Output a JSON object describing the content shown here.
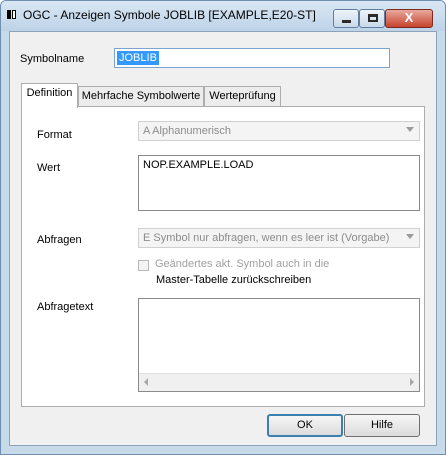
{
  "window": {
    "title": "OGC - Anzeigen Symbole JOBLIB [EXAMPLE,E20-ST]",
    "close_glyph": "X"
  },
  "symbolname": {
    "label": "Symbolname",
    "value": "JOBLIB"
  },
  "tabs": [
    {
      "label": "Definition",
      "active": true
    },
    {
      "label": "Mehrfache Symbolwerte",
      "active": false
    },
    {
      "label": "Werteprüfung",
      "active": false
    }
  ],
  "definition": {
    "format_label": "Format",
    "format_value": "A Alphanumerisch",
    "wert_label": "Wert",
    "wert_value": "NOP.EXAMPLE.LOAD",
    "abfragen_label": "Abfragen",
    "abfragen_value": "E Symbol nur abfragen, wenn es leer ist (Vorgabe)",
    "checkbox_line1": "Geändertes akt. Symbol auch in die",
    "checkbox_line2": "Master-Tabelle zurückschreiben",
    "checkbox_checked": false,
    "abfragetext_label": "Abfragetext",
    "abfragetext_value": ""
  },
  "buttons": {
    "ok": "OK",
    "help": "Hilfe"
  },
  "icons": {
    "system_menu": "window-system-icon",
    "minimize": "minimize-icon",
    "maximize": "maximize-icon",
    "close": "close-icon",
    "combo_arrow": "chevron-down-icon",
    "scroll_left": "arrow-left-icon",
    "scroll_right": "arrow-right-icon"
  },
  "colors": {
    "titlebar": "#c7daea",
    "selection": "#3399ff",
    "default_button_border": "#3c7fb1"
  }
}
